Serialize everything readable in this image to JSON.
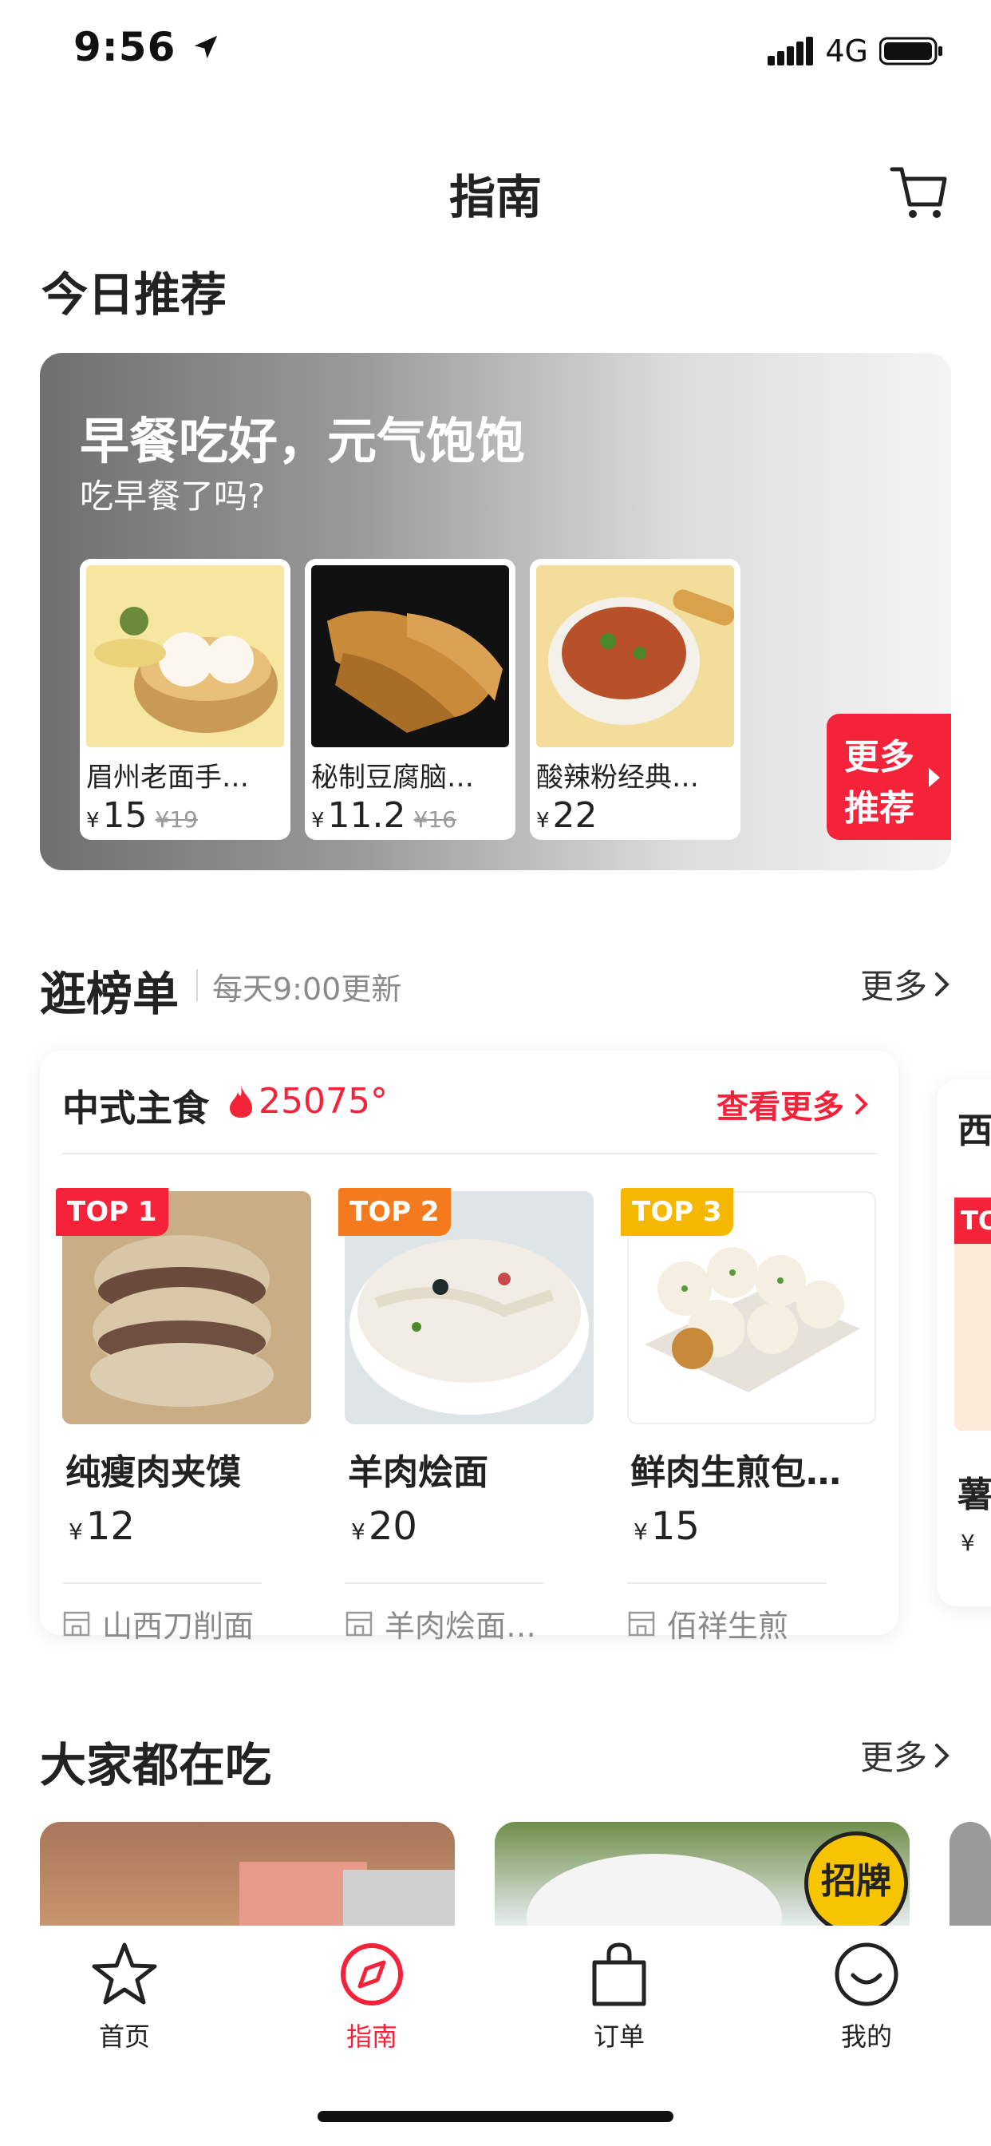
{
  "status_bar": {
    "time": "9:56",
    "network": "4G"
  },
  "nav": {
    "title": "指南"
  },
  "today": {
    "heading": "今日推荐",
    "banner_title": "早餐吃好，元气饱饱",
    "banner_subtitle": "吃早餐了吗?",
    "items": [
      {
        "name": "眉州老面手…",
        "currency": "¥",
        "price": "15",
        "original": "¥19"
      },
      {
        "name": "秘制豆腐脑…",
        "currency": "¥",
        "price": "11.2",
        "original": "¥16"
      },
      {
        "name": "酸辣粉经典…",
        "currency": "¥",
        "price": "22",
        "original": ""
      }
    ],
    "more_line1": "更多",
    "more_line2": "推荐"
  },
  "ranking": {
    "heading": "逛榜单",
    "subtitle": "每天9:00更新",
    "more": "更多",
    "card": {
      "category": "中式主食",
      "heat": "25075°",
      "view_more": "查看更多",
      "products": [
        {
          "badge": "TOP 1",
          "badge_color": "#f5233a",
          "name": "纯瘦肉夹馍",
          "currency": "¥",
          "price": "12",
          "shop": "山西刀削面"
        },
        {
          "badge": "TOP 2",
          "badge_color": "#f57a1e",
          "name": "羊肉烩面",
          "currency": "¥",
          "price": "20",
          "shop": "羊肉烩面…"
        },
        {
          "badge": "TOP 3",
          "badge_color": "#f5b800",
          "name": "鲜肉生煎包…",
          "currency": "¥",
          "price": "15",
          "shop": "佰祥生煎"
        }
      ]
    },
    "next_card": {
      "category_char": "西",
      "badge": "TO",
      "name_char": "薯",
      "currency": "¥"
    }
  },
  "everyone": {
    "heading": "大家都在吃",
    "more": "更多",
    "signature_badge": "招牌"
  },
  "tabs": [
    {
      "label": "首页",
      "icon": "star-icon",
      "active": false
    },
    {
      "label": "指南",
      "icon": "compass-icon",
      "active": true
    },
    {
      "label": "订单",
      "icon": "bag-icon",
      "active": false
    },
    {
      "label": "我的",
      "icon": "smile-icon",
      "active": false
    }
  ],
  "colors": {
    "accent": "#f5233a",
    "text": "#222222",
    "muted": "#8a8a8a"
  }
}
